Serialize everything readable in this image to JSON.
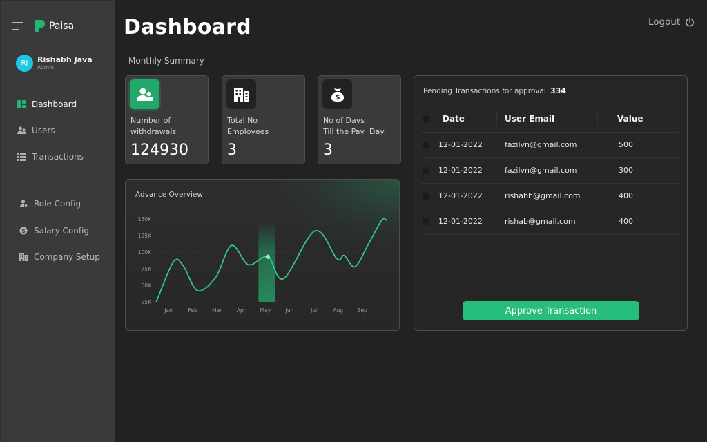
{
  "app": {
    "name": "Paisa",
    "brand_color": "#23b574"
  },
  "user": {
    "initials": "RJ",
    "name": "Rishabh Java",
    "role": "Admin",
    "avatar_color": "#1ec8e4"
  },
  "sidebar": {
    "primary": [
      {
        "label": "Dashboard",
        "icon": "dashboard-icon",
        "active": true
      },
      {
        "label": "Users",
        "icon": "users-icon",
        "active": false
      },
      {
        "label": "Transactions",
        "icon": "list-icon",
        "active": false
      }
    ],
    "secondary": [
      {
        "label": "Role Config",
        "icon": "role-icon"
      },
      {
        "label": "Salary Config",
        "icon": "salary-icon"
      },
      {
        "label": "Company Setup",
        "icon": "building-icon"
      }
    ]
  },
  "header": {
    "title": "Dashboard",
    "logout_label": "Logout"
  },
  "summary": {
    "title": "Monthly Summary",
    "cards": [
      {
        "label": "Number of withdrawals",
        "value": "124930",
        "icon": "users-icon"
      },
      {
        "label": "Total No Employees",
        "value": "3",
        "icon": "building-icon"
      },
      {
        "label": "No of Days Till the Pay  Day",
        "value": "3",
        "icon": "money-bag-icon"
      }
    ]
  },
  "chart_data": {
    "type": "line",
    "title": "Advance Overview",
    "xlabel": "",
    "ylabel": "",
    "categories": [
      "Jan",
      "Feb",
      "Mar",
      "Apr",
      "May",
      "Jun",
      "Jul",
      "Aug",
      "Sep"
    ],
    "y_ticks": [
      "25K",
      "50K",
      "75K",
      "100K",
      "125K",
      "150K"
    ],
    "ylim": [
      25000,
      150000
    ],
    "grid": true,
    "highlight_category": "May",
    "highlight_value": 93000,
    "series": [
      {
        "name": "Advance",
        "color": "#2ecc8a",
        "points": [
          {
            "x": -0.5,
            "y": 25000
          },
          {
            "x": 0.2,
            "y": 85000
          },
          {
            "x": 0.6,
            "y": 80000
          },
          {
            "x": 1.2,
            "y": 42000
          },
          {
            "x": 1.95,
            "y": 62000
          },
          {
            "x": 2.6,
            "y": 110000
          },
          {
            "x": 3.3,
            "y": 81000
          },
          {
            "x": 4.1,
            "y": 93000
          },
          {
            "x": 4.75,
            "y": 60000
          },
          {
            "x": 6.05,
            "y": 132000
          },
          {
            "x": 6.95,
            "y": 90000
          },
          {
            "x": 7.25,
            "y": 95000
          },
          {
            "x": 7.7,
            "y": 78000
          },
          {
            "x": 8.25,
            "y": 112000
          },
          {
            "x": 8.8,
            "y": 148000
          },
          {
            "x": 9.0,
            "y": 148000
          }
        ]
      }
    ]
  },
  "pending": {
    "title": "Pending Transactions for approval",
    "count": "334",
    "columns": [
      "Date",
      "User Email",
      "Value"
    ],
    "rows": [
      {
        "date": "12-01-2022",
        "email": "fazilvn@gmail.com",
        "value": "500"
      },
      {
        "date": "12-01-2022",
        "email": "fazilvn@gmail.com",
        "value": "300"
      },
      {
        "date": "12-01-2022",
        "email": "rishabh@gmail.com",
        "value": "400"
      },
      {
        "date": "12-01-2022",
        "email": "rishab@gmail.com",
        "value": "400"
      }
    ],
    "approve_label": "Approve Transaction",
    "accent": "#27bd7b"
  }
}
